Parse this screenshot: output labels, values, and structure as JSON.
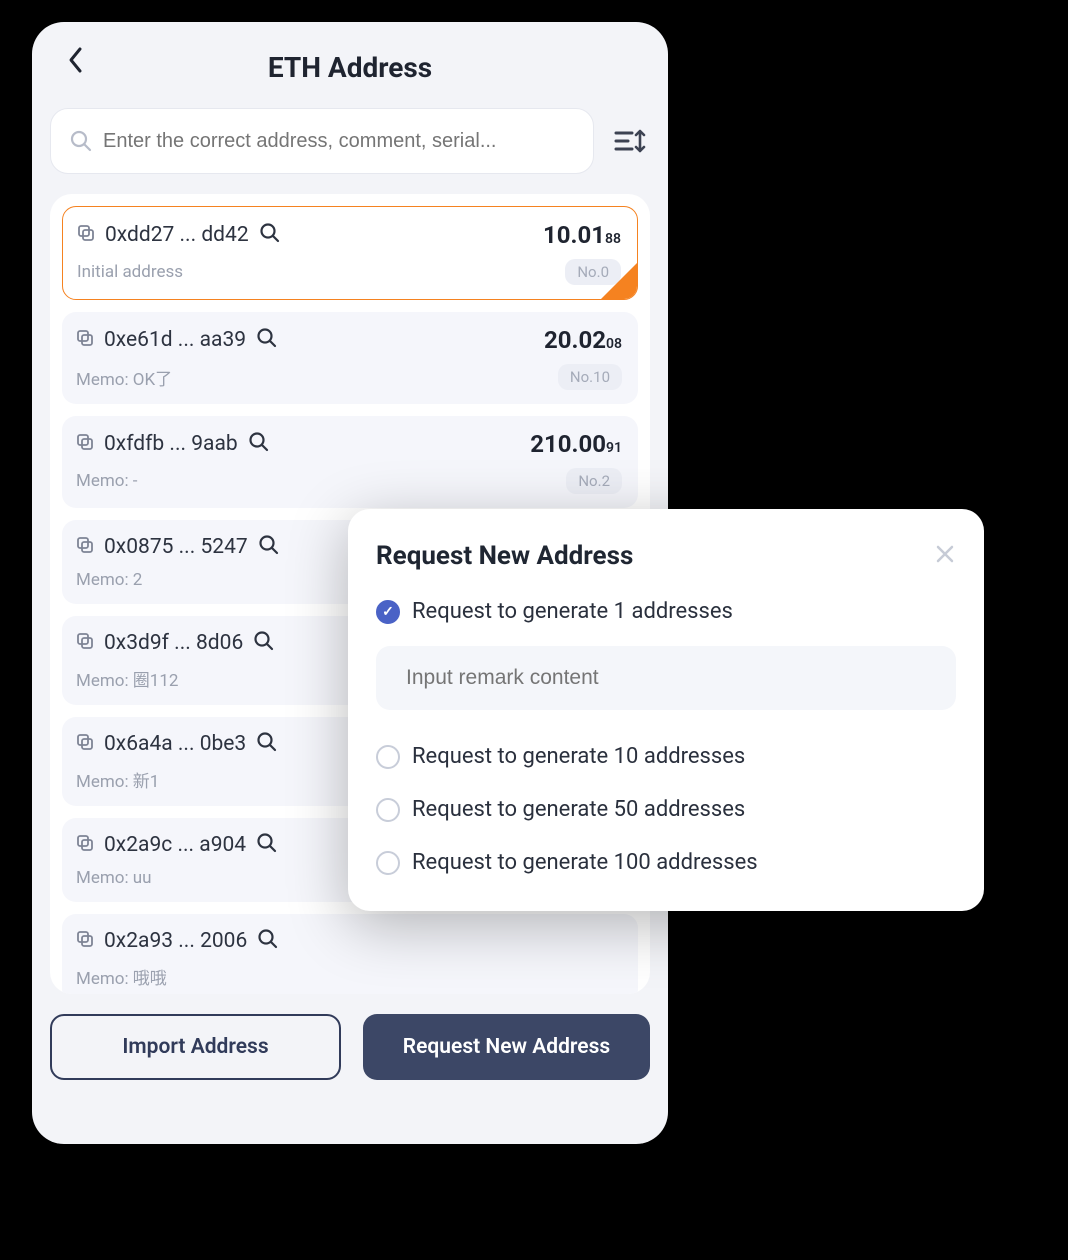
{
  "header": {
    "title": "ETH Address"
  },
  "search": {
    "placeholder": "Enter the correct address, comment, serial..."
  },
  "addresses": [
    {
      "addr": "0xdd27 ... dd42",
      "balance_main": "10.01",
      "balance_sub": "88",
      "memo": "Initial address",
      "num": "No.0",
      "selected": true
    },
    {
      "addr": "0xe61d ... aa39",
      "balance_main": "20.02",
      "balance_sub": "08",
      "memo": "Memo: OK了",
      "num": "No.10",
      "selected": false
    },
    {
      "addr": "0xfdfb ... 9aab",
      "balance_main": "210.00",
      "balance_sub": "91",
      "memo": "Memo: -",
      "num": "No.2",
      "selected": false
    },
    {
      "addr": "0x0875 ... 5247",
      "balance_main": "",
      "balance_sub": "",
      "memo": "Memo: 2",
      "num": "",
      "selected": false
    },
    {
      "addr": "0x3d9f ... 8d06",
      "balance_main": "",
      "balance_sub": "",
      "memo": "Memo: 圈112",
      "num": "",
      "selected": false
    },
    {
      "addr": "0x6a4a ... 0be3",
      "balance_main": "",
      "balance_sub": "",
      "memo": "Memo: 新1",
      "num": "",
      "selected": false
    },
    {
      "addr": "0x2a9c ... a904",
      "balance_main": "",
      "balance_sub": "",
      "memo": "Memo: uu",
      "num": "",
      "selected": false
    },
    {
      "addr": "0x2a93 ... 2006",
      "balance_main": "",
      "balance_sub": "",
      "memo": "Memo: 哦哦",
      "num": "",
      "selected": false
    }
  ],
  "bottom": {
    "import_label": "Import Address",
    "request_label": "Request New Address"
  },
  "modal": {
    "title": "Request New Address",
    "options": [
      {
        "label": "Request to generate 1 addresses",
        "checked": true
      },
      {
        "label": "Request to generate 10 addresses",
        "checked": false
      },
      {
        "label": "Request to generate 50 addresses",
        "checked": false
      },
      {
        "label": "Request to generate 100 addresses",
        "checked": false
      }
    ],
    "remark_placeholder": "Input remark content"
  }
}
